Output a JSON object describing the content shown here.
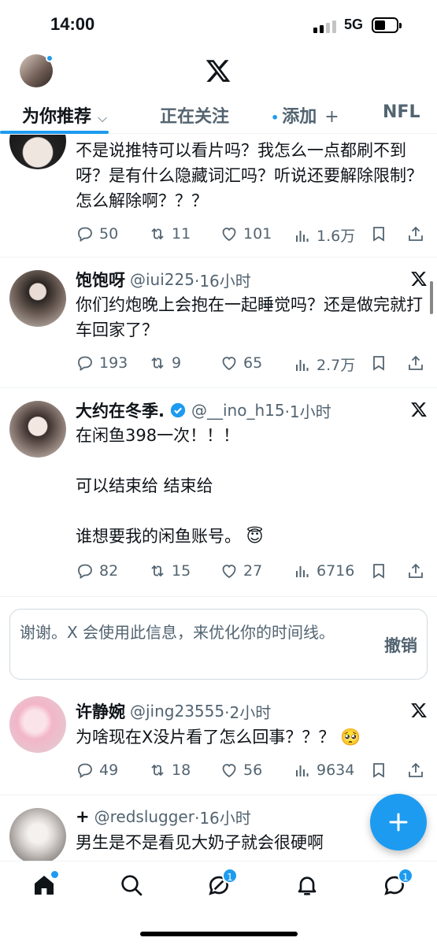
{
  "status_bar": {
    "time": "14:00",
    "network": "5G"
  },
  "header": {
    "logo": "x-logo",
    "avatar": "profile-avatar"
  },
  "tabs": [
    {
      "label": "为你推荐",
      "suffix": "⌵",
      "active": true
    },
    {
      "label": "正在关注"
    },
    {
      "label": "添加",
      "prefix": "•",
      "suffix": "+"
    },
    {
      "label": "NFL"
    }
  ],
  "tweets": [
    {
      "body": "不是说推特可以看片吗？我怎么一点都刷不到呀？是有什么隐藏词汇吗？听说还要解除限制？怎么解除啊？？？",
      "replies": "50",
      "retweets": "11",
      "likes": "101",
      "views": "1.6万"
    },
    {
      "name": "饱饱呀",
      "handle": "@iui225",
      "time": "·16小时",
      "body": "你们约炮晚上会抱在一起睡觉吗？还是做完就打车回家了？",
      "replies": "193",
      "retweets": "9",
      "likes": "65",
      "views": "2.7万"
    },
    {
      "name": "大约在冬季.",
      "handle": "@__ino_h15",
      "time": "·1小时",
      "body_lines": [
        "在闲鱼398一次！！！",
        "",
        "可以结束给  结束给",
        "",
        "谁想要我的闲鱼账号。 😇"
      ],
      "replies": "82",
      "retweets": "15",
      "likes": "27",
      "views": "6716"
    },
    {
      "name": "许静婉",
      "handle": "@jing23555",
      "time": "·2小时",
      "body": "为啥现在X没片看了怎么回事？？？ 🥺",
      "replies": "49",
      "retweets": "18",
      "likes": "56",
      "views": "9634"
    },
    {
      "name": "+",
      "handle": "@redslugger",
      "time": "·16小时",
      "body": "男生是不是看见大奶子就会很硬啊"
    }
  ],
  "feedback": {
    "message": "谢谢。X 会使用此信息，来优化你的时间线。",
    "undo": "撤销"
  },
  "bottom_nav": {
    "items": [
      "home-icon",
      "search-icon",
      "grok-icon",
      "notifications-icon",
      "messages-icon"
    ],
    "grok_badge": "1",
    "messages_badge": "1"
  },
  "colors": {
    "accent": "#1d9bf0",
    "text": "#0f1419",
    "secondary": "#536471"
  }
}
